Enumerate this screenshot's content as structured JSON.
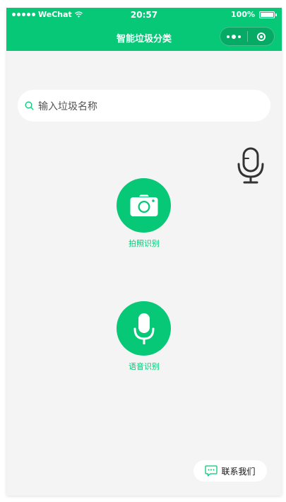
{
  "status_bar": {
    "carrier": "WeChat",
    "time": "20:57",
    "battery": "100%"
  },
  "nav": {
    "title": "智能垃圾分类"
  },
  "search": {
    "placeholder": "输入垃圾名称",
    "icon": "search-icon"
  },
  "actions": [
    {
      "label": "拍照识别",
      "icon": "camera-icon"
    },
    {
      "label": "语音识别",
      "icon": "microphone-icon"
    }
  ],
  "floating_mic": {
    "icon": "microphone-icon"
  },
  "contact": {
    "label": "联系我们",
    "icon": "chat-bubble-icon"
  },
  "colors": {
    "brand": "#07c877",
    "background": "#f4f4f4"
  }
}
